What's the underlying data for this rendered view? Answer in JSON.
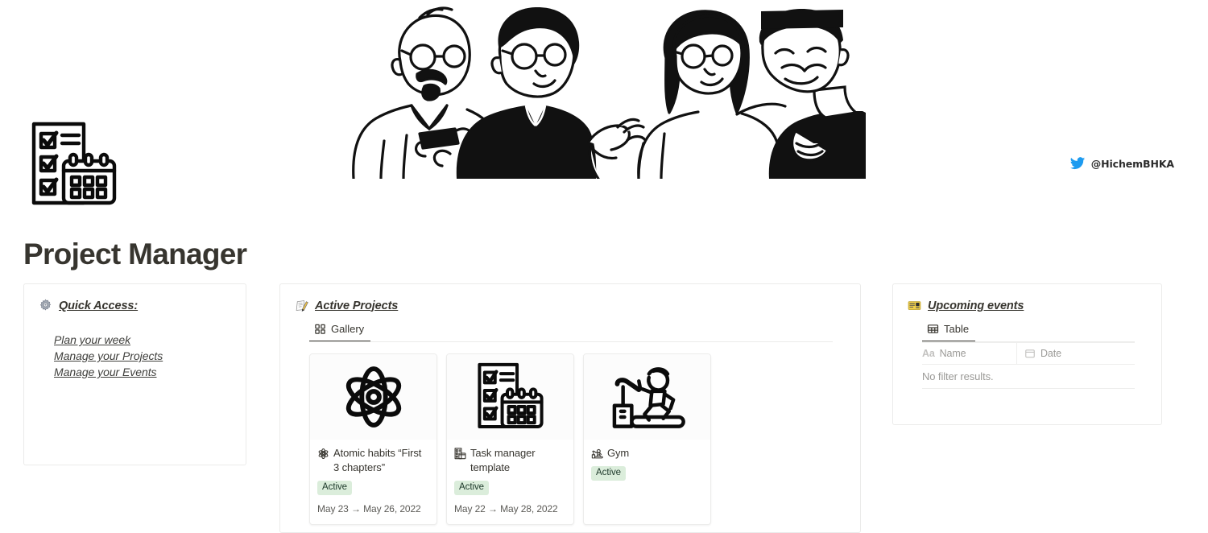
{
  "cover": {
    "illustration_name": "four-people-line-drawing-illustration",
    "credit": {
      "icon": "twitter-bird-icon",
      "handle": "@HichemBHKA",
      "color": "#1d9bf0"
    }
  },
  "page": {
    "icon": "checklist-calendar-icon",
    "title": "Project Manager"
  },
  "quick_access": {
    "icon": "gear-icon",
    "heading": "Quick Access:",
    "links": [
      {
        "label": "Plan your week"
      },
      {
        "label": "Manage your Projects"
      },
      {
        "label": "Manage your Events"
      }
    ]
  },
  "active_projects": {
    "icon": "memo-pencil-icon",
    "heading": "Active Projects",
    "view": {
      "icon": "gallery-grid-icon",
      "label": "Gallery"
    },
    "cards": [
      {
        "cover_icon": "atom-icon",
        "title_icon": "atom-icon",
        "title": "Atomic habits “First 3 chapters”",
        "status": "Active",
        "status_color": "#dbeddb",
        "date": "May 23 → May 26, 2022"
      },
      {
        "cover_icon": "checklist-calendar-icon",
        "title_icon": "checklist-calendar-icon",
        "title": "Task manager template",
        "status": "Active",
        "status_color": "#dbeddb",
        "date": "May 22 → May 28, 2022"
      },
      {
        "cover_icon": "treadmill-runner-icon",
        "title_icon": "treadmill-runner-icon",
        "title": "Gym",
        "status": "Active",
        "status_color": "#dbeddb",
        "date": ""
      }
    ]
  },
  "upcoming_events": {
    "icon": "ticket-icon",
    "heading": "Upcoming events",
    "view": {
      "icon": "table-grid-icon",
      "label": "Table"
    },
    "table": {
      "columns": [
        {
          "type_glyph": "Aa",
          "type_icon": "text-type-icon",
          "label": "Name"
        },
        {
          "type_glyph": "",
          "type_icon": "calendar-type-icon",
          "label": "Date"
        }
      ],
      "rows": [],
      "empty_message": "No filter results."
    }
  }
}
